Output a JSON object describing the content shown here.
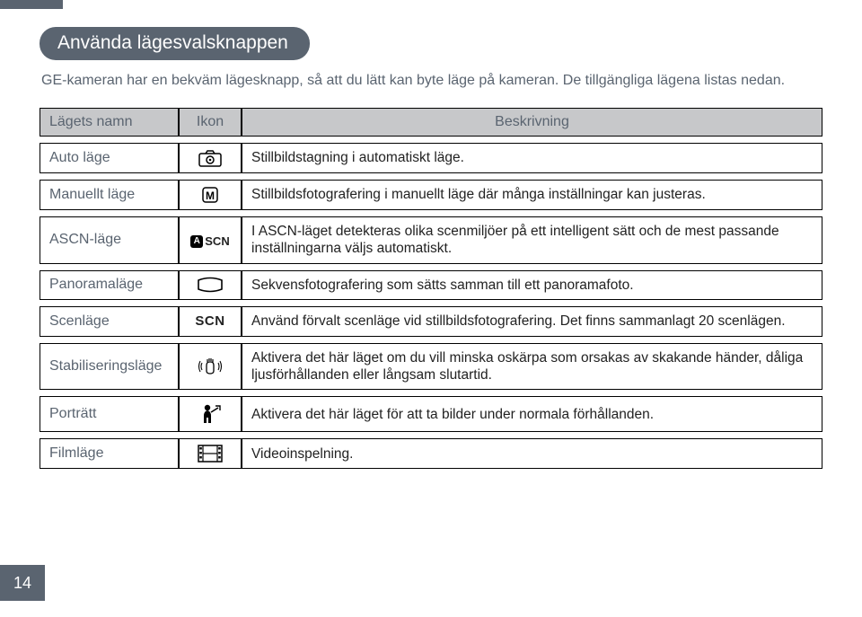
{
  "title": "Använda lägesvalsknappen",
  "intro": "GE-kameran har en bekväm lägesknapp, så att du lätt kan byte läge på kameran. De tillgängliga lägena listas nedan.",
  "header": {
    "name": "Lägets namn",
    "icon": "Ikon",
    "desc": "Beskrivning"
  },
  "rows": [
    {
      "name": "Auto läge",
      "icon": "camera-auto",
      "desc": "Stillbildstagning i automatiskt läge."
    },
    {
      "name": "Manuellt läge",
      "icon": "m-badge",
      "desc": "Stillbildsfotografering i manuellt läge där många inställningar kan justeras."
    },
    {
      "name": "ASCN-läge",
      "icon": "ascn",
      "desc": "I ASCN-läget detekteras olika scenmiljöer på ett intelligent sätt och de mest passande inställningarna väljs automatiskt."
    },
    {
      "name": "Panoramaläge",
      "icon": "panorama",
      "desc": "Sekvensfotografering som sätts samman till ett panoramafoto."
    },
    {
      "name": "Scenläge",
      "icon": "scn-text",
      "icon_text": "SCN",
      "desc": "Använd förvalt scenläge vid stillbildsfotografering. Det finns sammanlagt 20 scenlägen."
    },
    {
      "name": "Stabiliseringsläge",
      "icon": "stabilize",
      "desc": "Aktivera det här läget om du vill minska oskärpa som orsakas av skakande händer, dåliga ljusförhållanden eller långsam slutartid."
    },
    {
      "name": "Porträtt",
      "icon": "portrait",
      "desc": "Aktivera det här läget för att ta bilder under normala förhållanden."
    },
    {
      "name": "Filmläge",
      "icon": "film",
      "desc": "Videoinspelning."
    }
  ],
  "page_number": "14"
}
